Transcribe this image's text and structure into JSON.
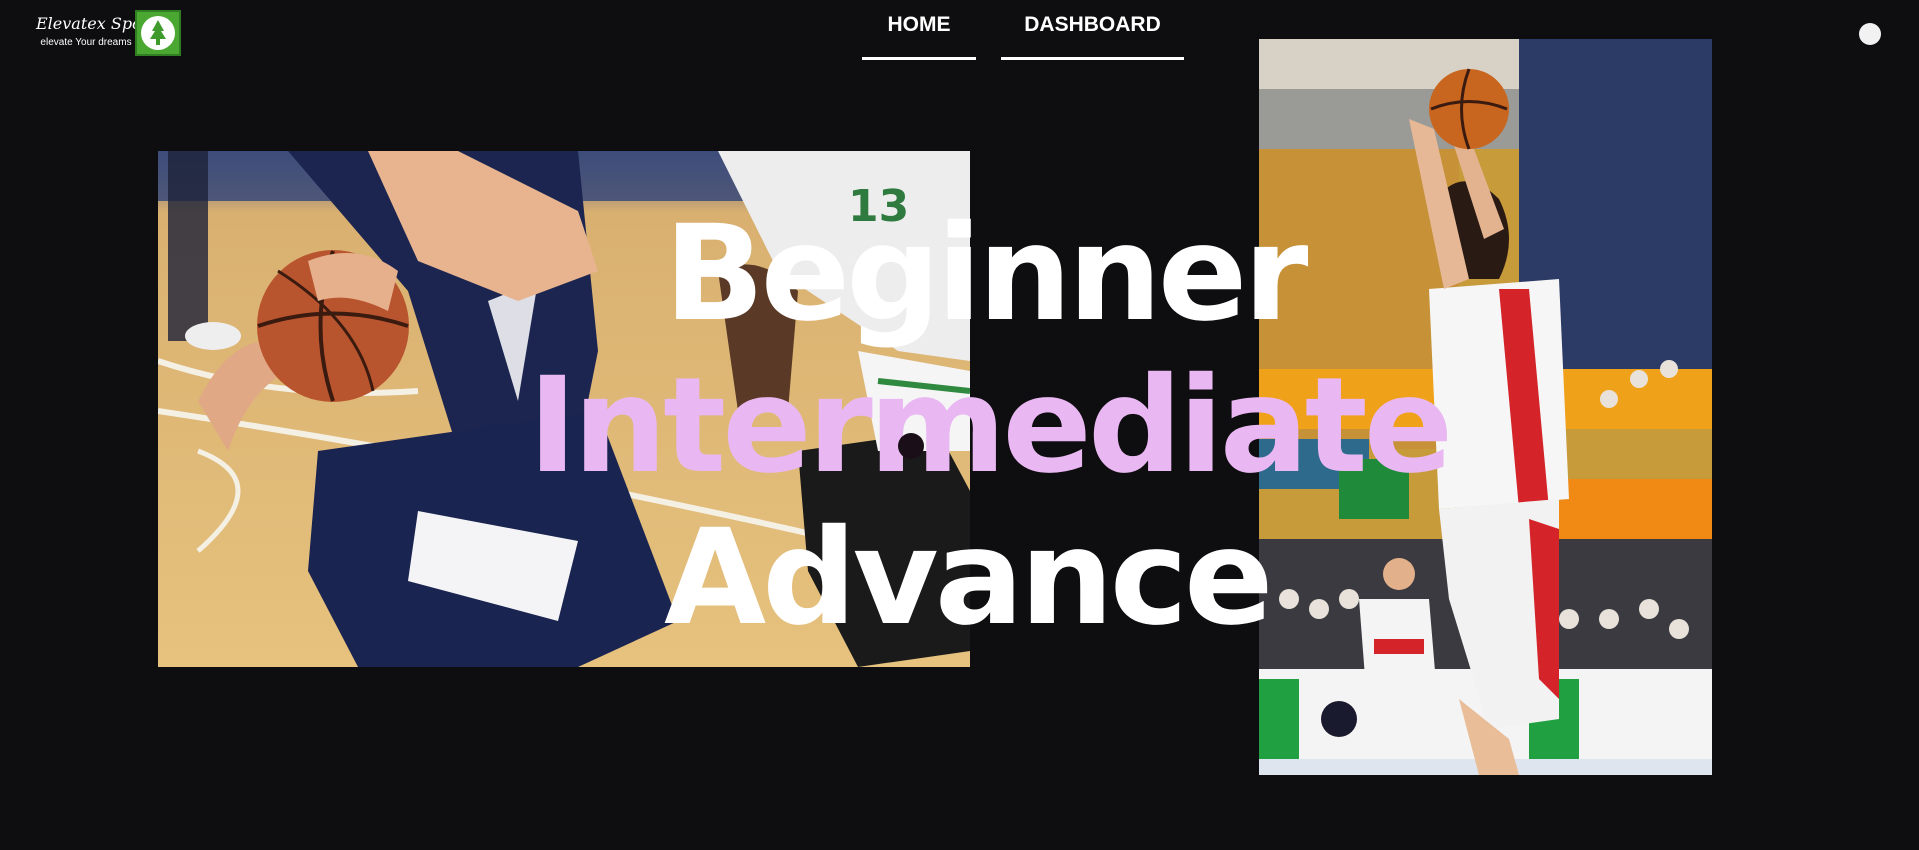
{
  "brand": {
    "name": "Elevatex Sports",
    "tagline": "elevate Your dreams",
    "logo_icon": "tree-icon",
    "logo_color": "#4aa832"
  },
  "nav": {
    "items": [
      {
        "label": "HOME",
        "active": true
      },
      {
        "label": "DASHBOARD",
        "active": false
      }
    ]
  },
  "user_menu": {
    "icon": "user-avatar-dot"
  },
  "hero": {
    "levels": [
      "Beginner",
      "Intermediate",
      "Advance"
    ],
    "highlight_color": "#e9b8f2",
    "background": "#0e0d0f"
  },
  "photos": {
    "left": "basketball-dribble-photo",
    "right": "basketball-jump-shot-photo"
  }
}
